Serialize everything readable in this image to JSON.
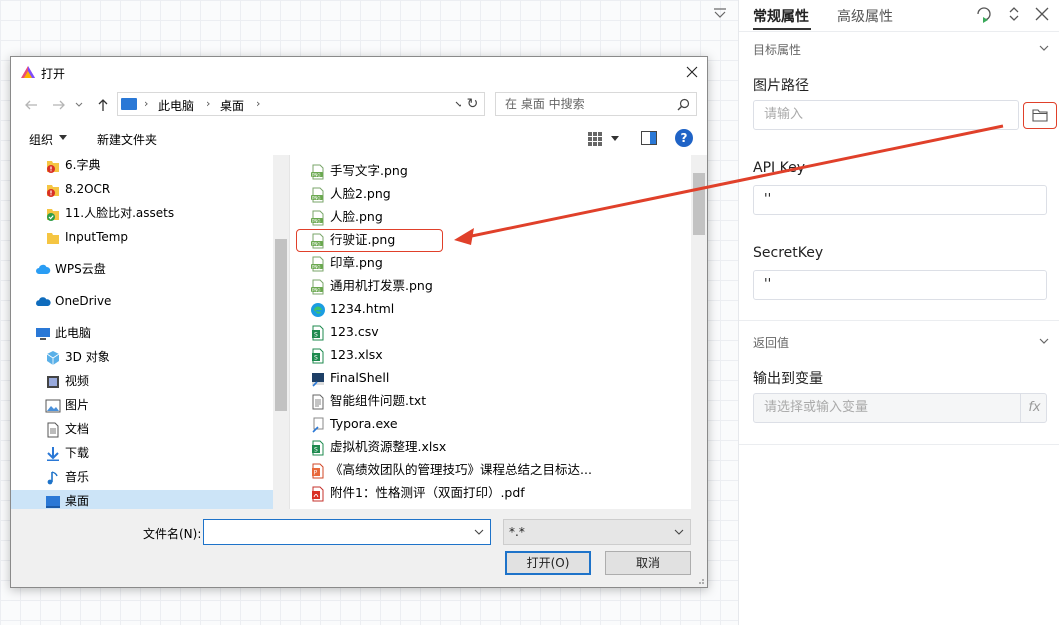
{
  "properties_panel": {
    "tabs": [
      {
        "label": "常规属性",
        "active": true
      },
      {
        "label": "高级属性",
        "active": false
      }
    ],
    "target_section": {
      "title": "目标属性",
      "image_path": {
        "label": "图片路径",
        "placeholder": "请输入"
      },
      "api_key": {
        "label": "API Key",
        "value": "''"
      },
      "secret_key": {
        "label": "SecretKey",
        "value": "''"
      }
    },
    "return_section": {
      "title": "返回值",
      "output_var": {
        "label": "输出到变量",
        "placeholder": "请选择或输入变量",
        "fx_label": "fx"
      }
    }
  },
  "dialog": {
    "title": "打开",
    "breadcrumb": [
      "此电脑",
      "桌面"
    ],
    "search_placeholder": "在 桌面 中搜索",
    "toolbar": {
      "organize": "组织",
      "new_folder": "新建文件夹",
      "help": "?"
    },
    "nav_items": [
      {
        "label": "6.字典",
        "icon": "warning-folder-icon"
      },
      {
        "label": "8.2OCR",
        "icon": "warning-folder-icon"
      },
      {
        "label": "11.人脸比对.assets",
        "icon": "synced-folder-icon"
      },
      {
        "label": "InputTemp",
        "icon": "folder-icon"
      },
      {
        "label": "WPS云盘",
        "icon": "cloud-icon"
      },
      {
        "label": "OneDrive",
        "icon": "onedrive-icon"
      },
      {
        "label": "此电脑",
        "icon": "computer-icon"
      },
      {
        "label": "3D 对象",
        "icon": "3d-objects-icon"
      },
      {
        "label": "视频",
        "icon": "video-icon"
      },
      {
        "label": "图片",
        "icon": "pictures-icon"
      },
      {
        "label": "文档",
        "icon": "documents-icon"
      },
      {
        "label": "下载",
        "icon": "download-icon"
      },
      {
        "label": "音乐",
        "icon": "music-icon"
      },
      {
        "label": "桌面",
        "icon": "desktop-icon",
        "selected": true
      }
    ],
    "files": [
      {
        "name": "手写文字.png",
        "icon": "png-file-icon"
      },
      {
        "name": "人脸2.png",
        "icon": "png-file-icon"
      },
      {
        "name": "人脸.png",
        "icon": "png-file-icon"
      },
      {
        "name": "行驶证.png",
        "icon": "png-file-icon",
        "highlighted": true
      },
      {
        "name": "印章.png",
        "icon": "png-file-icon"
      },
      {
        "name": "通用机打发票.png",
        "icon": "png-file-icon"
      },
      {
        "name": "1234.html",
        "icon": "edge-html-icon"
      },
      {
        "name": "123.csv",
        "icon": "csv-file-icon"
      },
      {
        "name": "123.xlsx",
        "icon": "xlsx-file-icon"
      },
      {
        "name": "FinalShell",
        "icon": "shortcut-icon"
      },
      {
        "name": "智能组件问题.txt",
        "icon": "txt-file-icon"
      },
      {
        "name": "Typora.exe",
        "icon": "exe-file-icon"
      },
      {
        "name": "虚拟机资源整理.xlsx",
        "icon": "xlsx-file-icon"
      },
      {
        "name": "《高绩效团队的管理技巧》课程总结之目标达...",
        "icon": "ppt-file-icon"
      },
      {
        "name": "附件1：性格测评（双面打印）.pdf",
        "icon": "pdf-file-icon"
      }
    ],
    "filename_label": "文件名(N):",
    "filename_value": "",
    "filetype_value": "*.*",
    "open_button": "打开(O)",
    "cancel_button": "取消"
  },
  "colors": {
    "annotation_red": "#e0402a",
    "selection_blue": "#cce4f7",
    "accent_blue": "#1e73c9"
  }
}
